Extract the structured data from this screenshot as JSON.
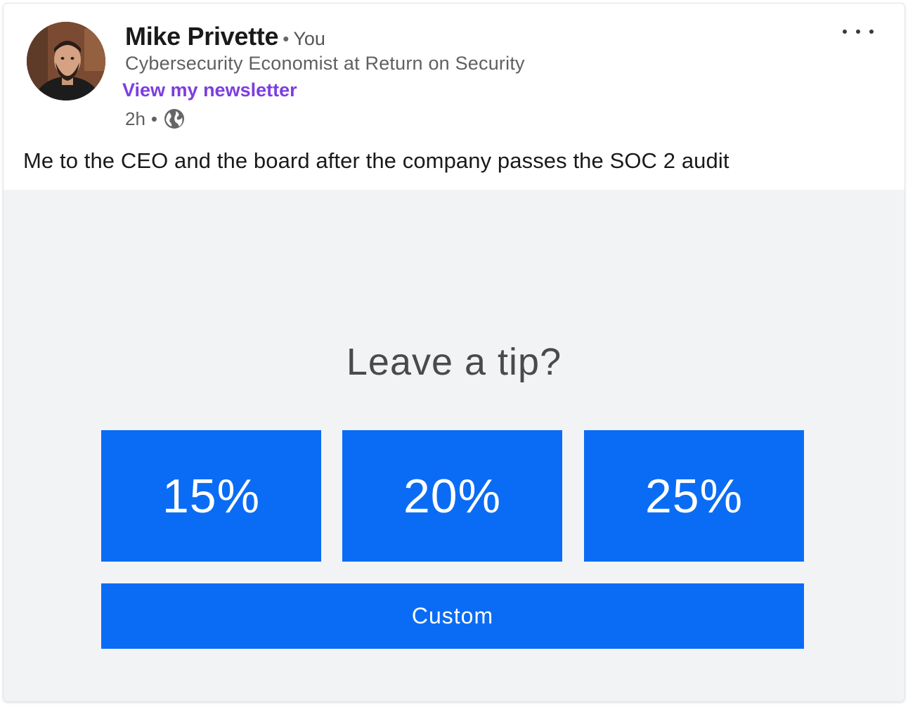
{
  "post": {
    "author": {
      "name": "Mike Privette",
      "separator": "•",
      "relation": "You",
      "headline": "Cybersecurity Economist at Return on Security",
      "link_text": "View my newsletter"
    },
    "meta": {
      "time": "2h",
      "separator": "•",
      "visibility_icon": "globe-icon"
    },
    "more_icon": "more-options-icon",
    "text": "Me to the CEO and the board after the company passes the SOC 2 audit"
  },
  "media": {
    "prompt": "Leave a tip?",
    "tip_options": [
      "15%",
      "20%",
      "25%"
    ],
    "custom_label": "Custom"
  },
  "colors": {
    "link": "#7c3ee0",
    "button": "#0a6cf5",
    "media_bg": "#f2f3f5"
  }
}
